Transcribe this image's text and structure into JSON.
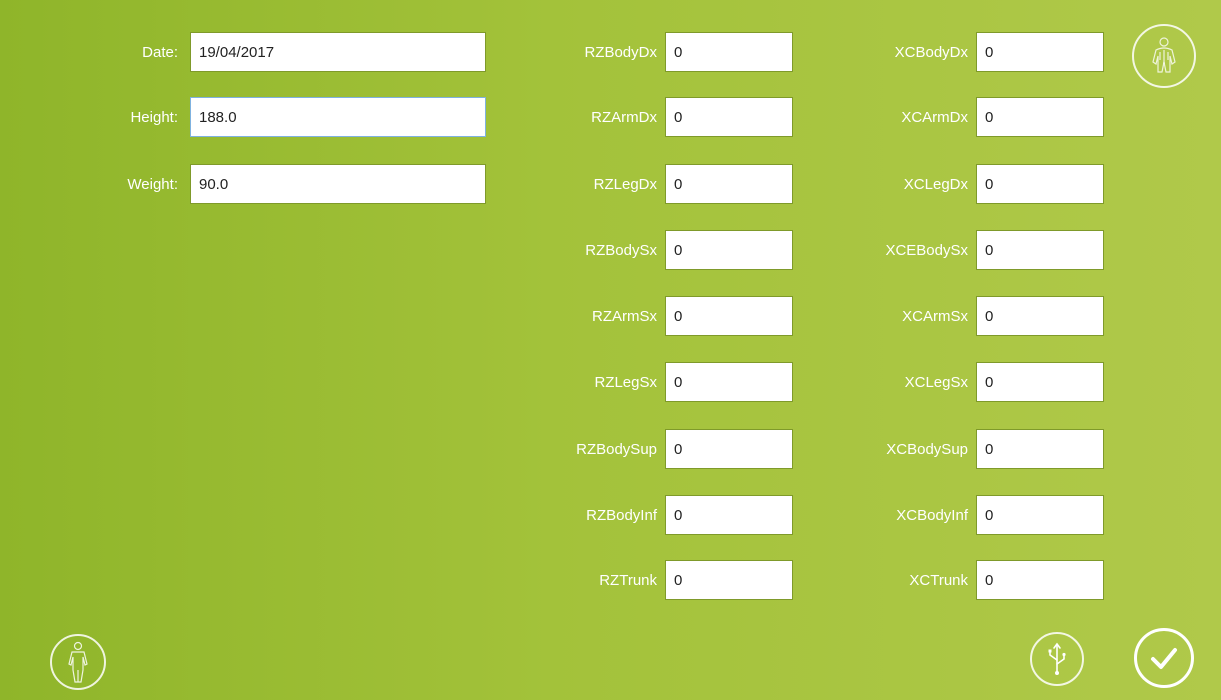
{
  "left_fields": [
    {
      "label": "Date:",
      "value": "19/04/2017"
    },
    {
      "label": "Height:",
      "value": "188.0"
    },
    {
      "label": "Weight:",
      "value": "90.0"
    }
  ],
  "mid_fields": [
    {
      "label": "RZBodyDx",
      "value": "0"
    },
    {
      "label": "RZArmDx",
      "value": "0"
    },
    {
      "label": "RZLegDx",
      "value": "0"
    },
    {
      "label": "RZBodySx",
      "value": "0"
    },
    {
      "label": "RZArmSx",
      "value": "0"
    },
    {
      "label": "RZLegSx",
      "value": "0"
    },
    {
      "label": "RZBodySup",
      "value": "0"
    },
    {
      "label": "RZBodyInf",
      "value": "0"
    },
    {
      "label": "RZTrunk",
      "value": "0"
    }
  ],
  "right_fields": [
    {
      "label": "XCBodyDx",
      "value": "0"
    },
    {
      "label": "XCArmDx",
      "value": "0"
    },
    {
      "label": "XCLegDx",
      "value": "0"
    },
    {
      "label": "XCEBodySx",
      "value": "0"
    },
    {
      "label": "XCArmSx",
      "value": "0"
    },
    {
      "label": "XCLegSx",
      "value": "0"
    },
    {
      "label": "XCBodySup",
      "value": "0"
    },
    {
      "label": "XCBodyInf",
      "value": "0"
    },
    {
      "label": "XCTrunk",
      "value": "0"
    }
  ],
  "icons": {
    "top_right": "body-muscles-icon",
    "bottom_left": "body-figure-icon",
    "usb": "usb-icon",
    "confirm": "checkmark-icon"
  }
}
